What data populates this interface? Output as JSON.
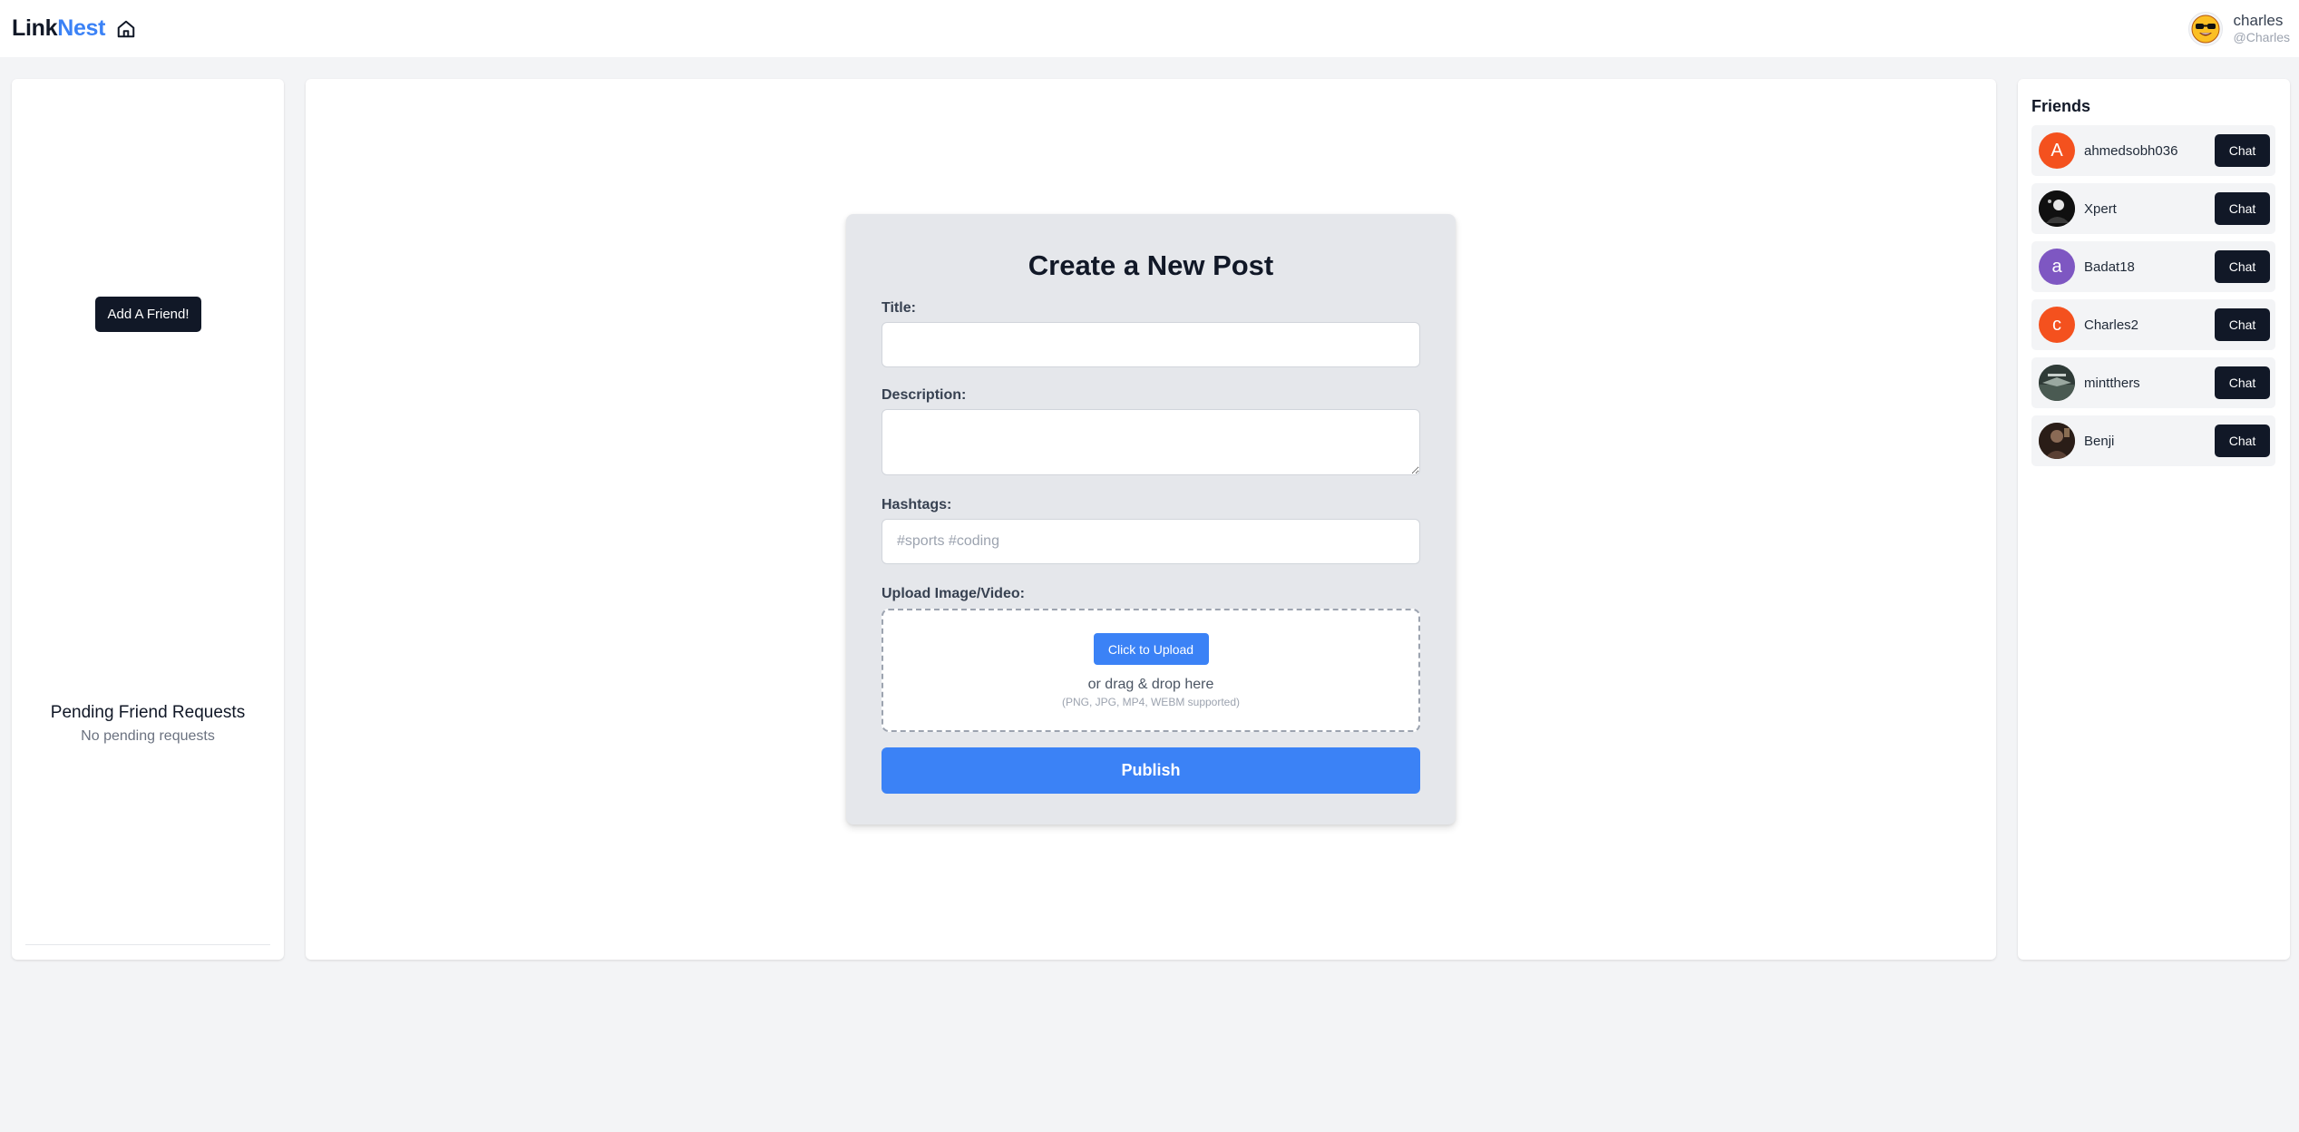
{
  "header": {
    "brand_part1": "Link",
    "brand_part2": "Nest",
    "home_icon": "home-icon",
    "user": {
      "display_name": "charles",
      "handle": "@Charles",
      "avatar_icon": "sunglasses-emoji-avatar"
    }
  },
  "left_panel": {
    "add_friend_label": "Add A Friend!",
    "pending_title": "Pending Friend Requests",
    "pending_empty": "No pending requests"
  },
  "post_form": {
    "heading": "Create a New Post",
    "title_label": "Title:",
    "title_value": "",
    "description_label": "Description:",
    "description_value": "",
    "hashtags_label": "Hashtags:",
    "hashtags_placeholder": "#sports #coding",
    "upload_label": "Upload Image/Video:",
    "upload_button": "Click to Upload",
    "upload_drag_text": "or drag & drop here",
    "upload_formats": "(PNG, JPG, MP4, WEBM supported)",
    "publish_button": "Publish"
  },
  "friends": {
    "title": "Friends",
    "chat_label": "Chat",
    "items": [
      {
        "name": "ahmedsobh036",
        "initial": "A",
        "avatar_color": "#f4511e",
        "photo": false
      },
      {
        "name": "Xpert",
        "initial": "",
        "avatar_color": "#1a1a1a",
        "photo": true
      },
      {
        "name": "Badat18",
        "initial": "a",
        "avatar_color": "#7e57c2",
        "photo": false
      },
      {
        "name": "Charles2",
        "initial": "c",
        "avatar_color": "#f4511e",
        "photo": false
      },
      {
        "name": "mintthers",
        "initial": "",
        "avatar_color": "#3a4a44",
        "photo": true
      },
      {
        "name": "Benji",
        "initial": "",
        "avatar_color": "#3b2a22",
        "photo": true
      }
    ]
  },
  "colors": {
    "accent": "#3b82f6",
    "dark_button": "#111827",
    "page_bg": "#f3f4f6",
    "card_bg": "#e5e7eb"
  }
}
